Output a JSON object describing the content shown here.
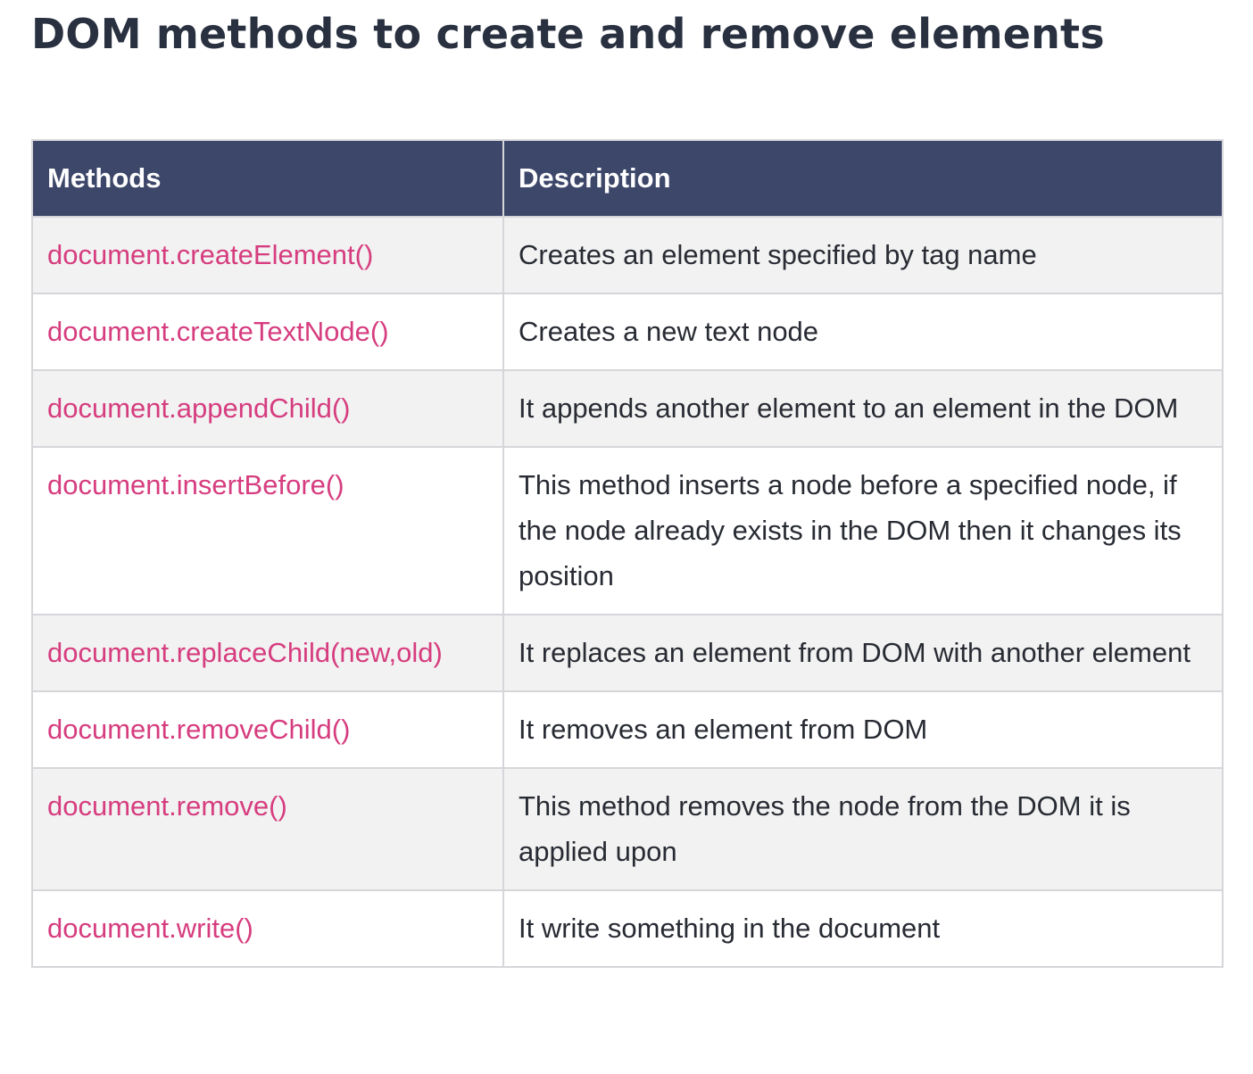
{
  "title": "DOM methods to create and remove elements",
  "table": {
    "headers": {
      "method": "Methods",
      "description": "Description"
    },
    "rows": [
      {
        "method": "document.createElement()",
        "description": "Creates an element specified by tag name"
      },
      {
        "method": "document.createTextNode()",
        "description": "Creates a new text node"
      },
      {
        "method": "document.appendChild()",
        "description": "It appends another element to an element in the DOM"
      },
      {
        "method": "document.insertBefore()",
        "description": "This method inserts a node before a specified node, if the node already exists in the DOM then it changes its position"
      },
      {
        "method": "document.replaceChild(new,old)",
        "description": "It replaces an element from DOM with another element"
      },
      {
        "method": "document.removeChild()",
        "description": "It removes an element from DOM"
      },
      {
        "method": "document.remove()",
        "description": "This method removes the node from the DOM it is applied upon"
      },
      {
        "method": "document.write()",
        "description": "It write something in the document"
      }
    ]
  },
  "colors": {
    "title": "#293040",
    "header_bg": "#3d476a",
    "header_text": "#ffffff",
    "method_text": "#d63d7f",
    "body_text": "#282b33",
    "row_alt_bg": "#f2f2f2",
    "border": "#d6d6da"
  }
}
